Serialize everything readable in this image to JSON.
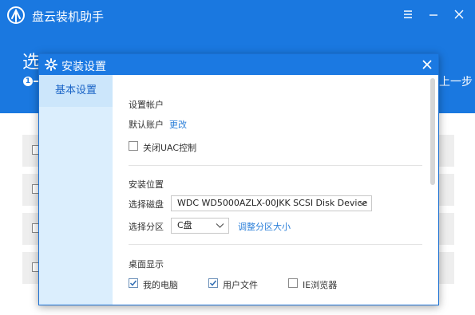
{
  "app": {
    "title": "盘云装机助手",
    "step_title": "选",
    "step_number": "1",
    "prev_label": "上一步"
  },
  "dialog": {
    "title": "安装设置",
    "sidebar": {
      "items": [
        {
          "label": "基本设置"
        }
      ]
    },
    "account": {
      "section_title": "设置帐户",
      "default_account_label": "默认账户",
      "change_link": "更改",
      "disable_uac_label": "关闭UAC控制",
      "disable_uac_checked": false
    },
    "install_location": {
      "section_title": "安装位置",
      "disk_label": "选择磁盘",
      "disk_value": "WDC WD5000AZLX-00JKK SCSI Disk Device",
      "partition_label": "选择分区",
      "partition_value": "C盘",
      "resize_link": "调整分区大小"
    },
    "desktop": {
      "section_title": "桌面显示",
      "options": [
        {
          "label": "我的电脑",
          "checked": true
        },
        {
          "label": "用户文件",
          "checked": true
        },
        {
          "label": "IE浏览器",
          "checked": false
        }
      ]
    }
  },
  "colors": {
    "brand_blue": "#1a78e0",
    "link_blue": "#2b7fd9",
    "sidebar_bg": "#dbeefd"
  }
}
